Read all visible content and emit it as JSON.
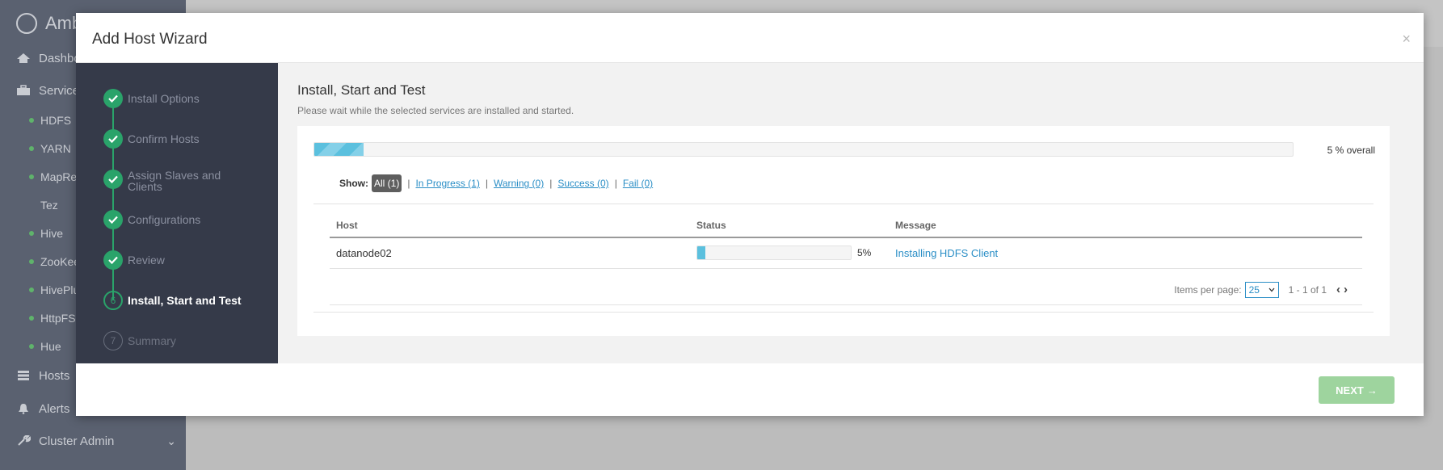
{
  "background": {
    "brand": "Amb",
    "sidebar_items": [
      {
        "label": "Dashbo",
        "type": "main",
        "icon": "home-icon"
      },
      {
        "label": "Service",
        "type": "main",
        "icon": "briefcase-icon"
      },
      {
        "label": "HDFS",
        "type": "service",
        "status": "green"
      },
      {
        "label": "YARN",
        "type": "service",
        "status": "green"
      },
      {
        "label": "MapRe",
        "type": "service",
        "status": "green"
      },
      {
        "label": "Tez",
        "type": "service",
        "status": "none"
      },
      {
        "label": "Hive",
        "type": "service",
        "status": "green"
      },
      {
        "label": "ZooKee",
        "type": "service",
        "status": "green"
      },
      {
        "label": "HivePlu",
        "type": "service",
        "status": "green"
      },
      {
        "label": "HttpFS",
        "type": "service",
        "status": "green"
      },
      {
        "label": "Hue",
        "type": "service",
        "status": "green"
      },
      {
        "label": "Hosts",
        "type": "main",
        "icon": "server-icon"
      },
      {
        "label": "Alerts",
        "type": "main",
        "icon": "bell-icon"
      },
      {
        "label": "Cluster Admin",
        "type": "main",
        "icon": "wrench-icon"
      }
    ]
  },
  "modal": {
    "title": "Add Host Wizard",
    "close_label": "×",
    "steps": [
      {
        "number": "1",
        "label": "Install Options",
        "state": "done"
      },
      {
        "number": "2",
        "label": "Confirm Hosts",
        "state": "done"
      },
      {
        "number": "3",
        "label": "Assign Slaves and Clients",
        "state": "done"
      },
      {
        "number": "4",
        "label": "Configurations",
        "state": "done"
      },
      {
        "number": "5",
        "label": "Review",
        "state": "done"
      },
      {
        "number": "6",
        "label": "Install, Start and Test",
        "state": "current"
      },
      {
        "number": "7",
        "label": "Summary",
        "state": "future"
      }
    ],
    "content": {
      "title": "Install, Start and Test",
      "subtitle": "Please wait while the selected services are installed and started.",
      "overall_progress": 5,
      "overall_label": "5 % overall",
      "filters": {
        "show_label": "Show:",
        "all": "All (1)",
        "in_progress": "In Progress (1)",
        "warning": "Warning (0)",
        "success": "Success (0)",
        "fail": "Fail (0)"
      },
      "table": {
        "headers": [
          "Host",
          "Status",
          "Message"
        ],
        "rows": [
          {
            "host": "datanode02",
            "progress": 5,
            "progress_label": "5%",
            "message": "Installing HDFS Client"
          }
        ]
      },
      "pager": {
        "items_per_page_label": "Items per page:",
        "items_per_page": "25",
        "range": "1 - 1 of 1"
      }
    },
    "footer": {
      "next_label": "NEXT",
      "next_arrow": "→"
    }
  },
  "colors": {
    "accent": "#2aa36a",
    "link": "#2a8ec6",
    "progress": "#5bc0de",
    "next_button": "#9ed49e",
    "nav_background": "#353a49"
  }
}
